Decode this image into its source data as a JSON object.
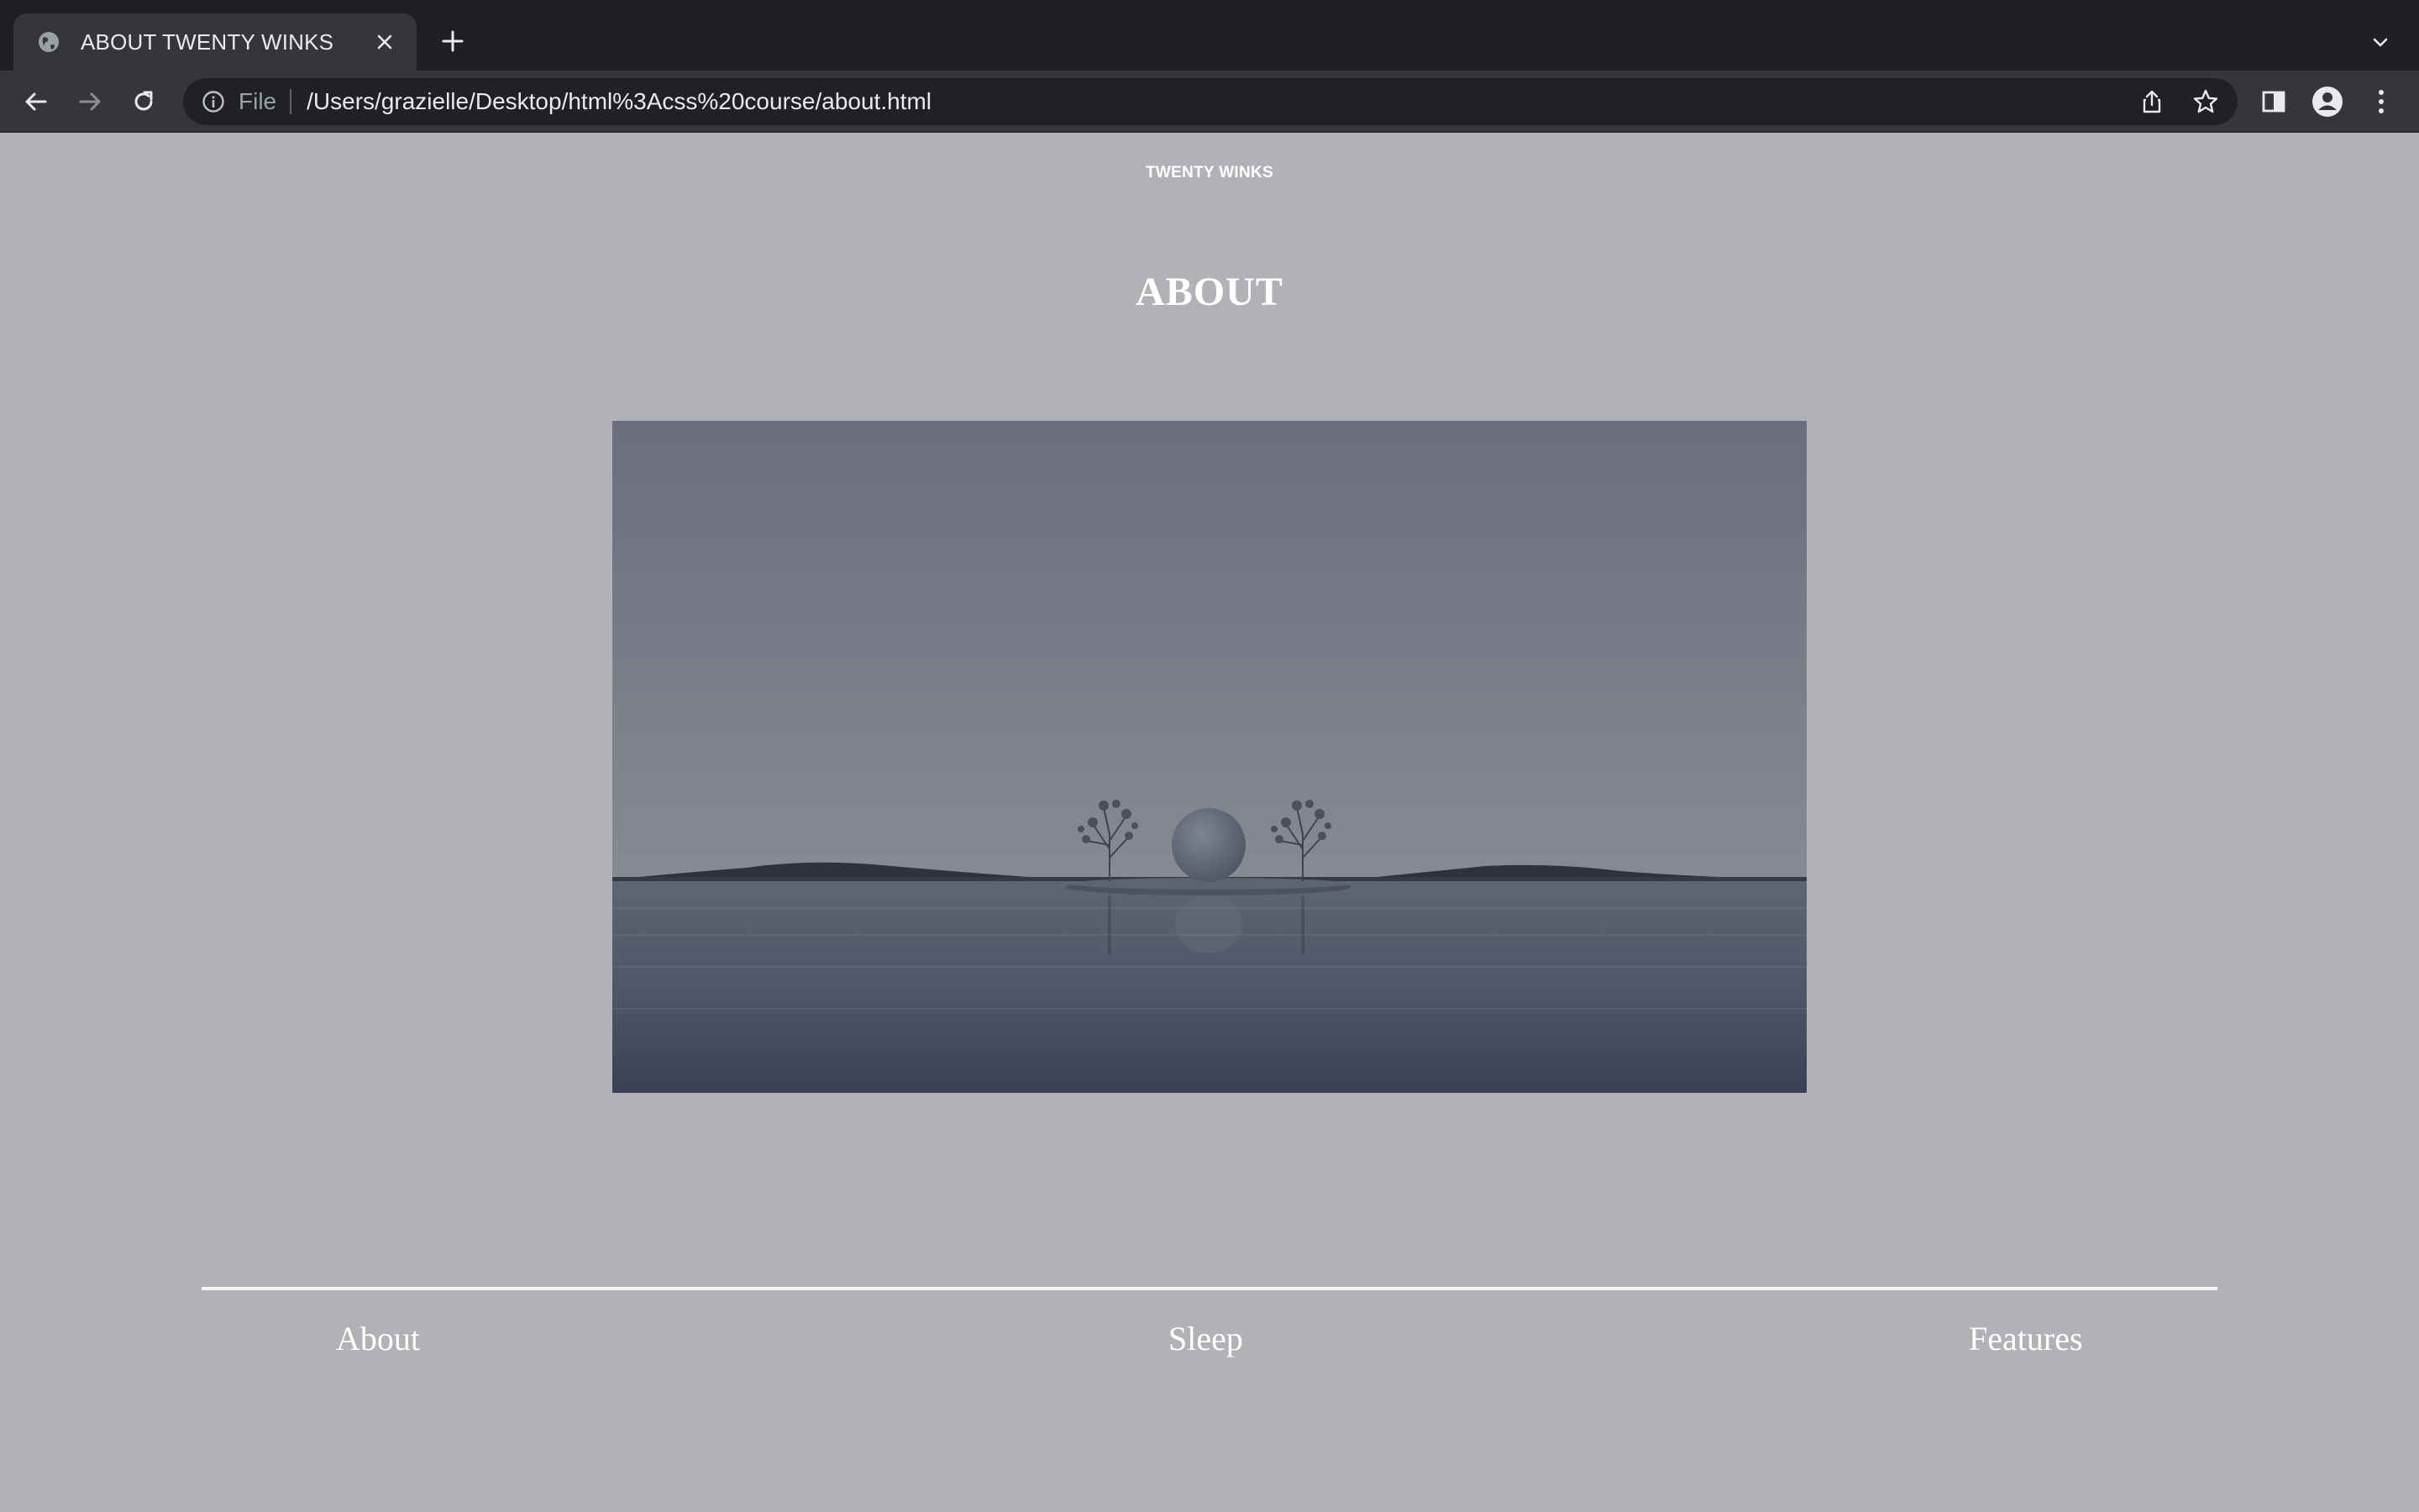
{
  "browser": {
    "tab": {
      "title": "ABOUT TWENTY WINKS"
    },
    "address_bar": {
      "scheme_label": "File",
      "url": "/Users/grazielle/Desktop/html%3Acss%20course/about.html"
    },
    "icons": {
      "favicon": "globe-icon",
      "tab_close": "close-icon",
      "new_tab": "plus-icon",
      "tab_search": "chevron-down-icon",
      "back": "arrow-left-icon",
      "forward": "arrow-right-icon",
      "reload": "reload-icon",
      "site_info": "info-icon",
      "share": "share-icon",
      "bookmark": "star-icon",
      "side_panel": "side-panel-icon",
      "profile": "profile-icon",
      "menu": "kebab-menu-icon"
    }
  },
  "page": {
    "site_name": "TWENTY WINKS",
    "heading": "ABOUT",
    "hero_image": "Twilight lake with a small island holding a sphere between two trees",
    "footer_nav": [
      {
        "label": "About"
      },
      {
        "label": "Sleep"
      },
      {
        "label": "Features"
      }
    ]
  },
  "colors": {
    "page_background": "#b1b2b6",
    "text": "#ffffff",
    "tabstrip": "#1f2024",
    "toolbar": "#35363a",
    "omnibox": "#202124"
  }
}
